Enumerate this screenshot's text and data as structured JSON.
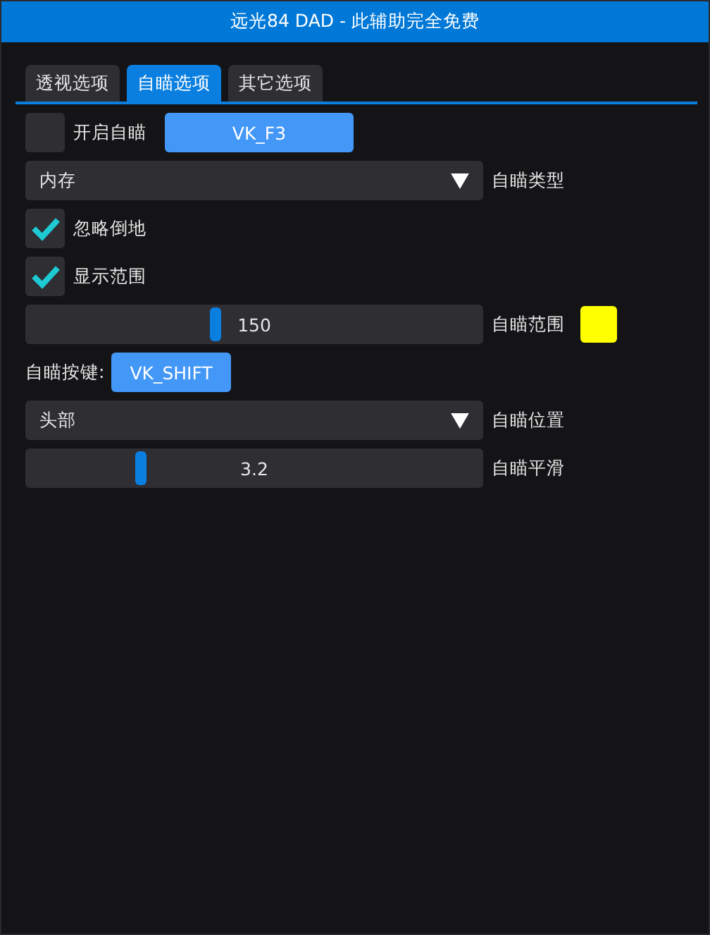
{
  "window": {
    "title": "远光84 DAD - 此辅助完全免费"
  },
  "tabs": [
    {
      "label": "透视选项",
      "selected": false
    },
    {
      "label": "自瞄选项",
      "selected": true
    },
    {
      "label": "其它选项",
      "selected": false
    }
  ],
  "rows": [
    {
      "kind": "toggle_key",
      "label": "开启自瞄",
      "checked": false,
      "button": "VK_F3"
    },
    {
      "kind": "combo",
      "value": "内存",
      "side_label": "自瞄类型"
    },
    {
      "kind": "checkbox",
      "label": "忽略倒地",
      "checked": true
    },
    {
      "kind": "checkbox",
      "label": "显示范围",
      "checked": true
    },
    {
      "kind": "slider",
      "reading": "150",
      "level": 0.41,
      "label": "自瞄范围",
      "color": "#ffff00"
    },
    {
      "kind": "key",
      "label": "自瞄按键:",
      "button": "VK_SHIFT"
    },
    {
      "kind": "combo",
      "value": "头部",
      "side_label": "自瞄位置"
    },
    {
      "kind": "slider",
      "reading": "3.2",
      "level": 0.24,
      "label": "自瞄平滑"
    }
  ]
}
